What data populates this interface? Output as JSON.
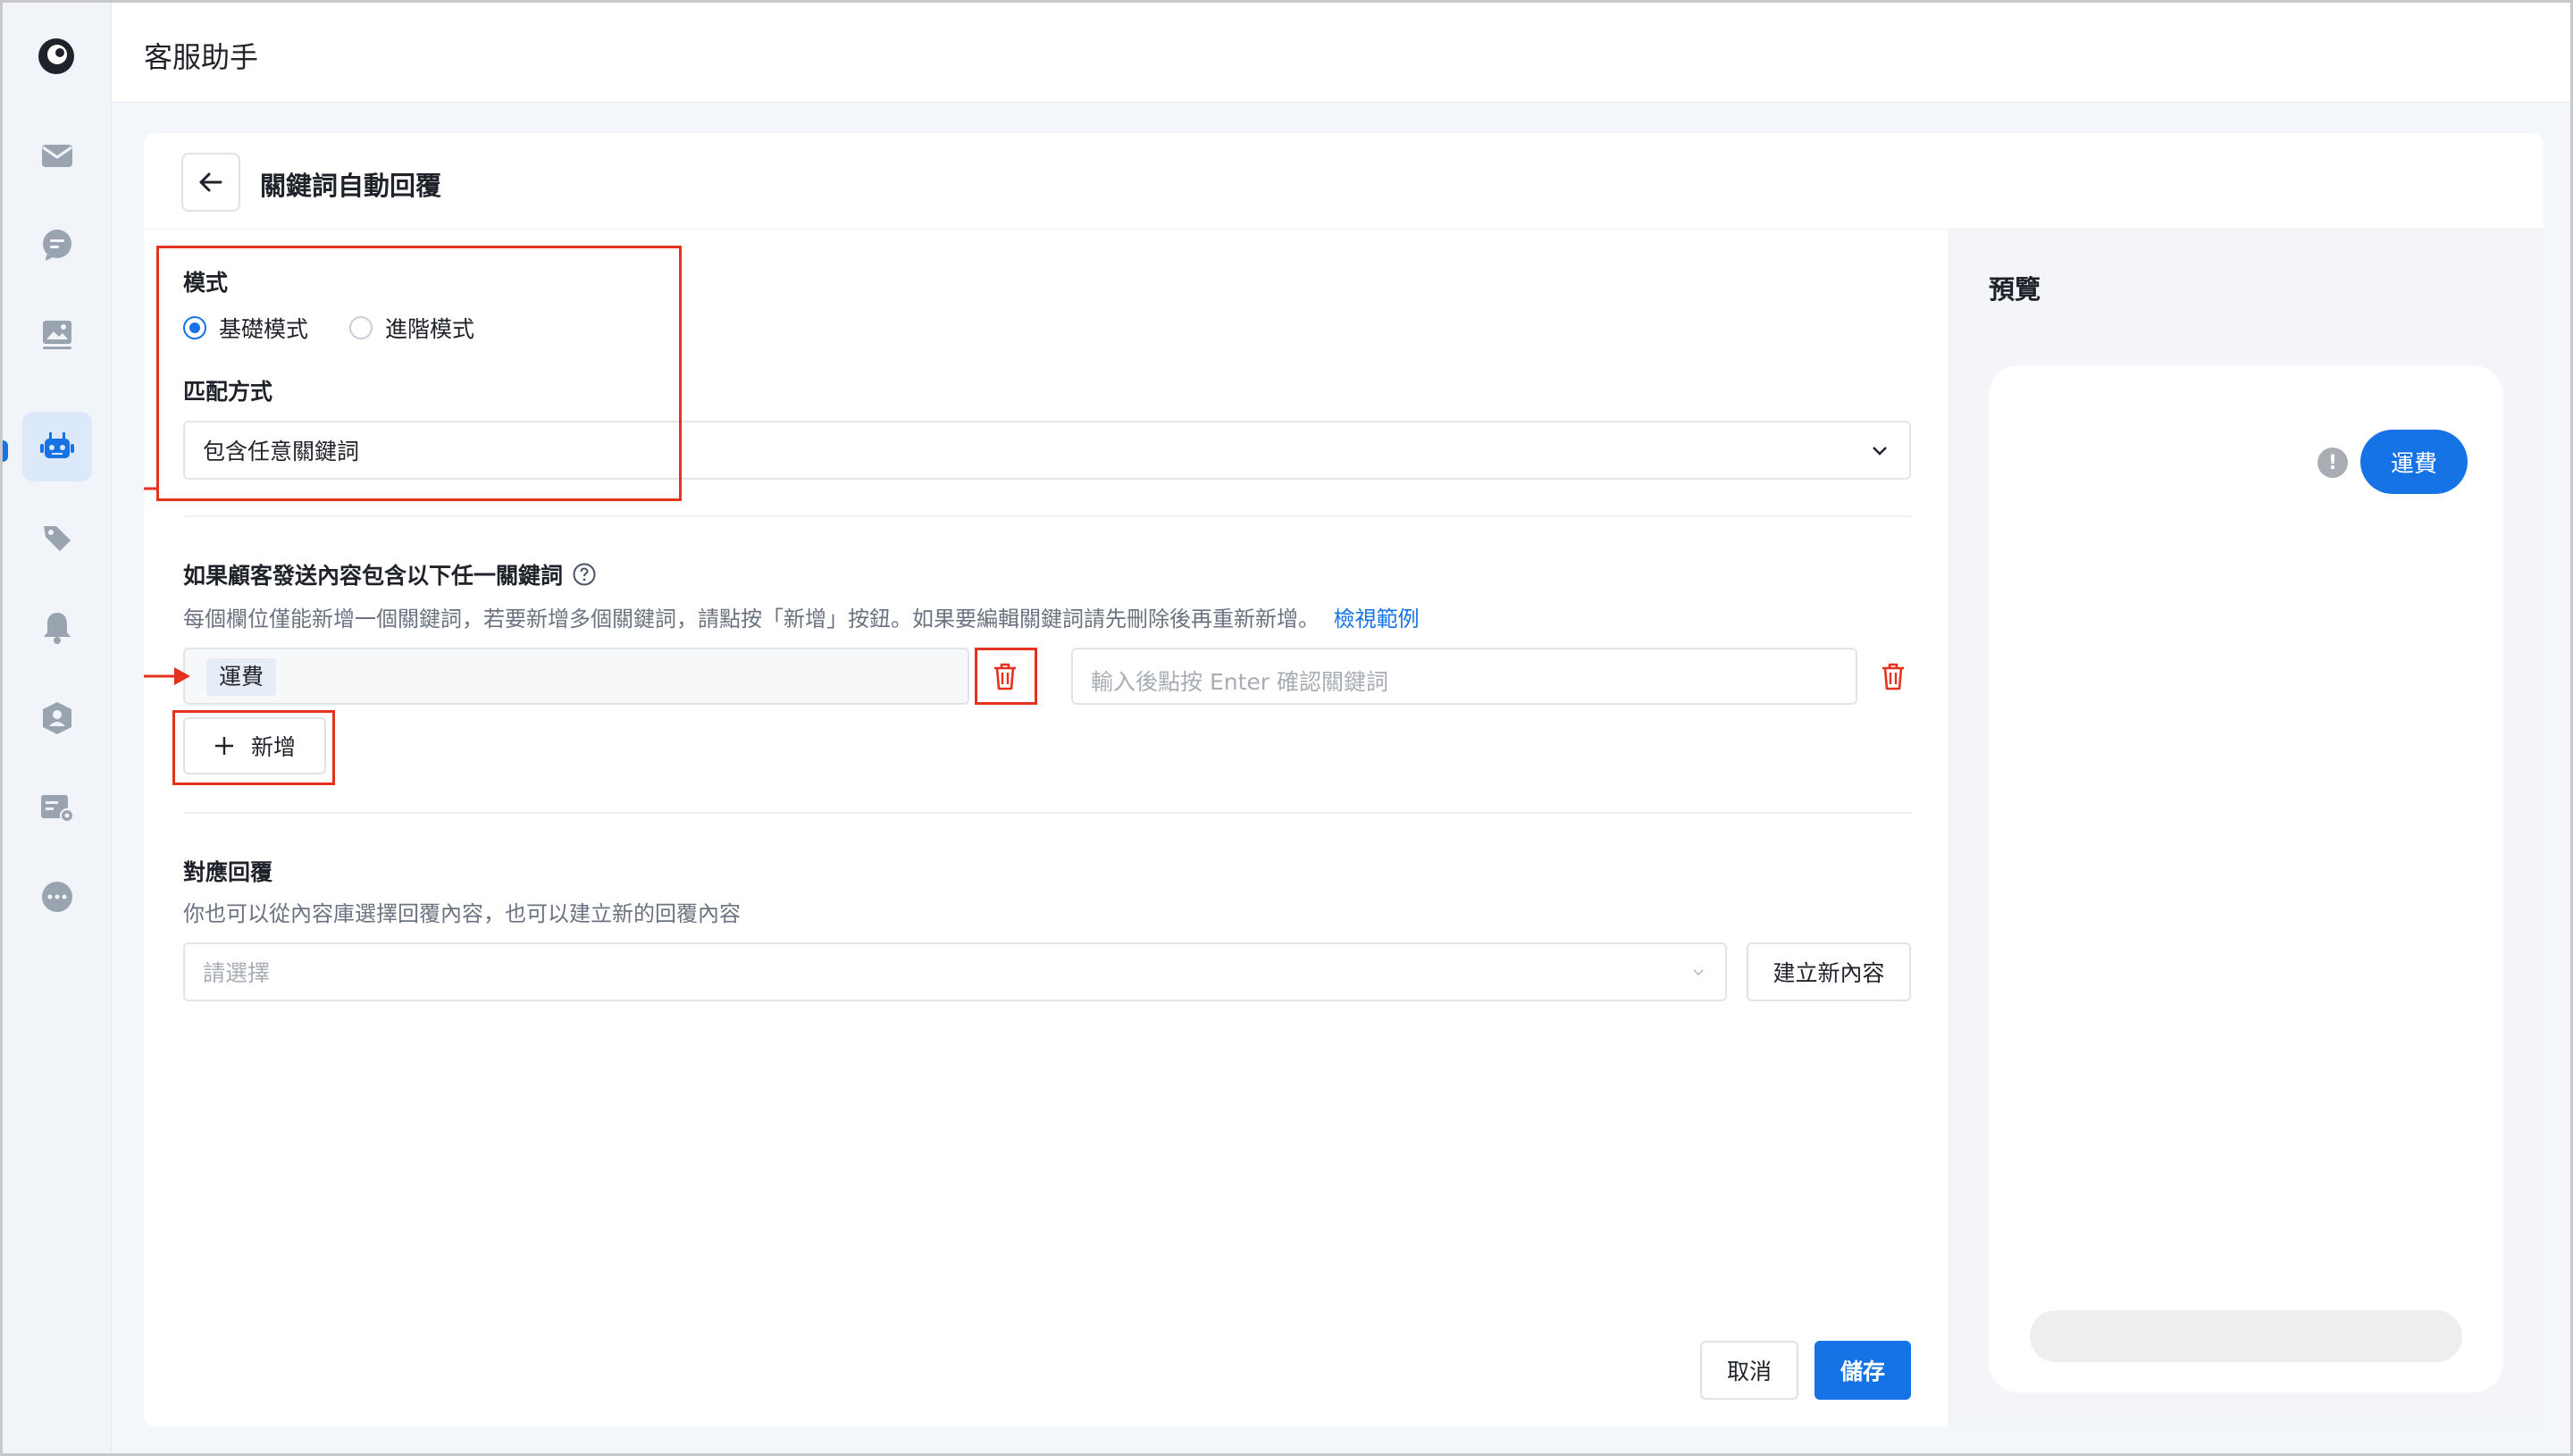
{
  "app": {
    "title": "客服助手"
  },
  "sidebar": {
    "items": [
      {
        "icon": "mail-icon"
      },
      {
        "icon": "chat-icon"
      },
      {
        "icon": "image-icon"
      },
      {
        "icon": "bot-icon",
        "active": true
      },
      {
        "icon": "tag-icon"
      },
      {
        "icon": "bell-icon"
      },
      {
        "icon": "user-shield-icon"
      },
      {
        "icon": "settings-card-icon"
      },
      {
        "icon": "more-icon"
      }
    ]
  },
  "page": {
    "title": "關鍵詞自動回覆"
  },
  "mode": {
    "label": "模式",
    "options": [
      {
        "label": "基礎模式",
        "selected": true
      },
      {
        "label": "進階模式",
        "selected": false
      }
    ]
  },
  "match": {
    "label": "匹配方式",
    "value": "包含任意關鍵詞"
  },
  "keywords": {
    "title": "如果顧客發送內容包含以下任一關鍵詞",
    "help": "每個欄位僅能新增一個關鍵詞，若要新增多個關鍵詞，請點按「新增」按鈕。如果要編輯關鍵詞請先刪除後再重新新增。",
    "example_link": "檢視範例",
    "items": [
      {
        "tag": "運費"
      }
    ],
    "new_placeholder": "輸入後點按 Enter 確認關鍵詞",
    "add_label": "新增"
  },
  "reply": {
    "title": "對應回覆",
    "help": "你也可以從內容庫選擇回覆內容，也可以建立新的回覆內容",
    "select_placeholder": "請選擇",
    "create_label": "建立新內容"
  },
  "footer": {
    "cancel_label": "取消",
    "save_label": "儲存"
  },
  "preview": {
    "title": "預覽",
    "bubble_text": "運費",
    "warn_symbol": "!"
  },
  "colors": {
    "accent": "#1673e6",
    "annotation": "#e5321e",
    "danger": "#e5321e"
  }
}
